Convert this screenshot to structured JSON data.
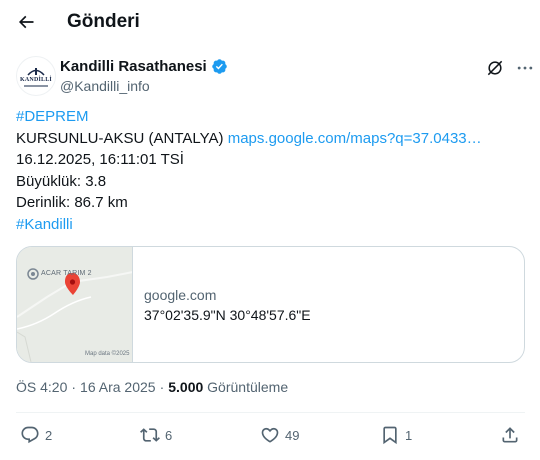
{
  "header": {
    "title": "Gönderi"
  },
  "author": {
    "name": "Kandilli Rasathanesi",
    "handle": "@Kandilli_info",
    "avatar_text": "KANDİLLİ"
  },
  "tweet": {
    "hashtag1": "#DEPREM",
    "location": "KURSUNLU-AKSU (ANTALYA)",
    "maps_link": "maps.google.com/maps?q=37.0433…",
    "datetime": "16.12.2025, 16:11:01 TSİ",
    "magnitude": "Büyüklük: 3.8",
    "depth": "Derinlik: 86.7 km",
    "hashtag2": "#Kandilli"
  },
  "card": {
    "map_label": "ACAR TARIM 2",
    "map_attribution": "Map data ©2025",
    "domain": "google.com",
    "title": "37°02'35.9\"N 30°48'57.6\"E"
  },
  "meta": {
    "time": "ÖS 4:20",
    "separator": "·",
    "date": "16 Ara 2025",
    "views_count": "5.000",
    "views_label": "Görüntüleme"
  },
  "actions": {
    "replies": "2",
    "reposts": "6",
    "likes": "49",
    "bookmarks": "1"
  },
  "icons": {
    "back": "arrow-left-icon",
    "verified": "verified-badge-icon",
    "grok": "grok-icon",
    "more": "more-icon",
    "reply": "reply-icon",
    "repost": "repost-icon",
    "like": "heart-icon",
    "bookmark": "bookmark-icon",
    "share": "share-icon"
  },
  "colors": {
    "accent": "#1d9bf0",
    "muted": "#536471",
    "text": "#0f1419",
    "pin": "#ea4335"
  }
}
